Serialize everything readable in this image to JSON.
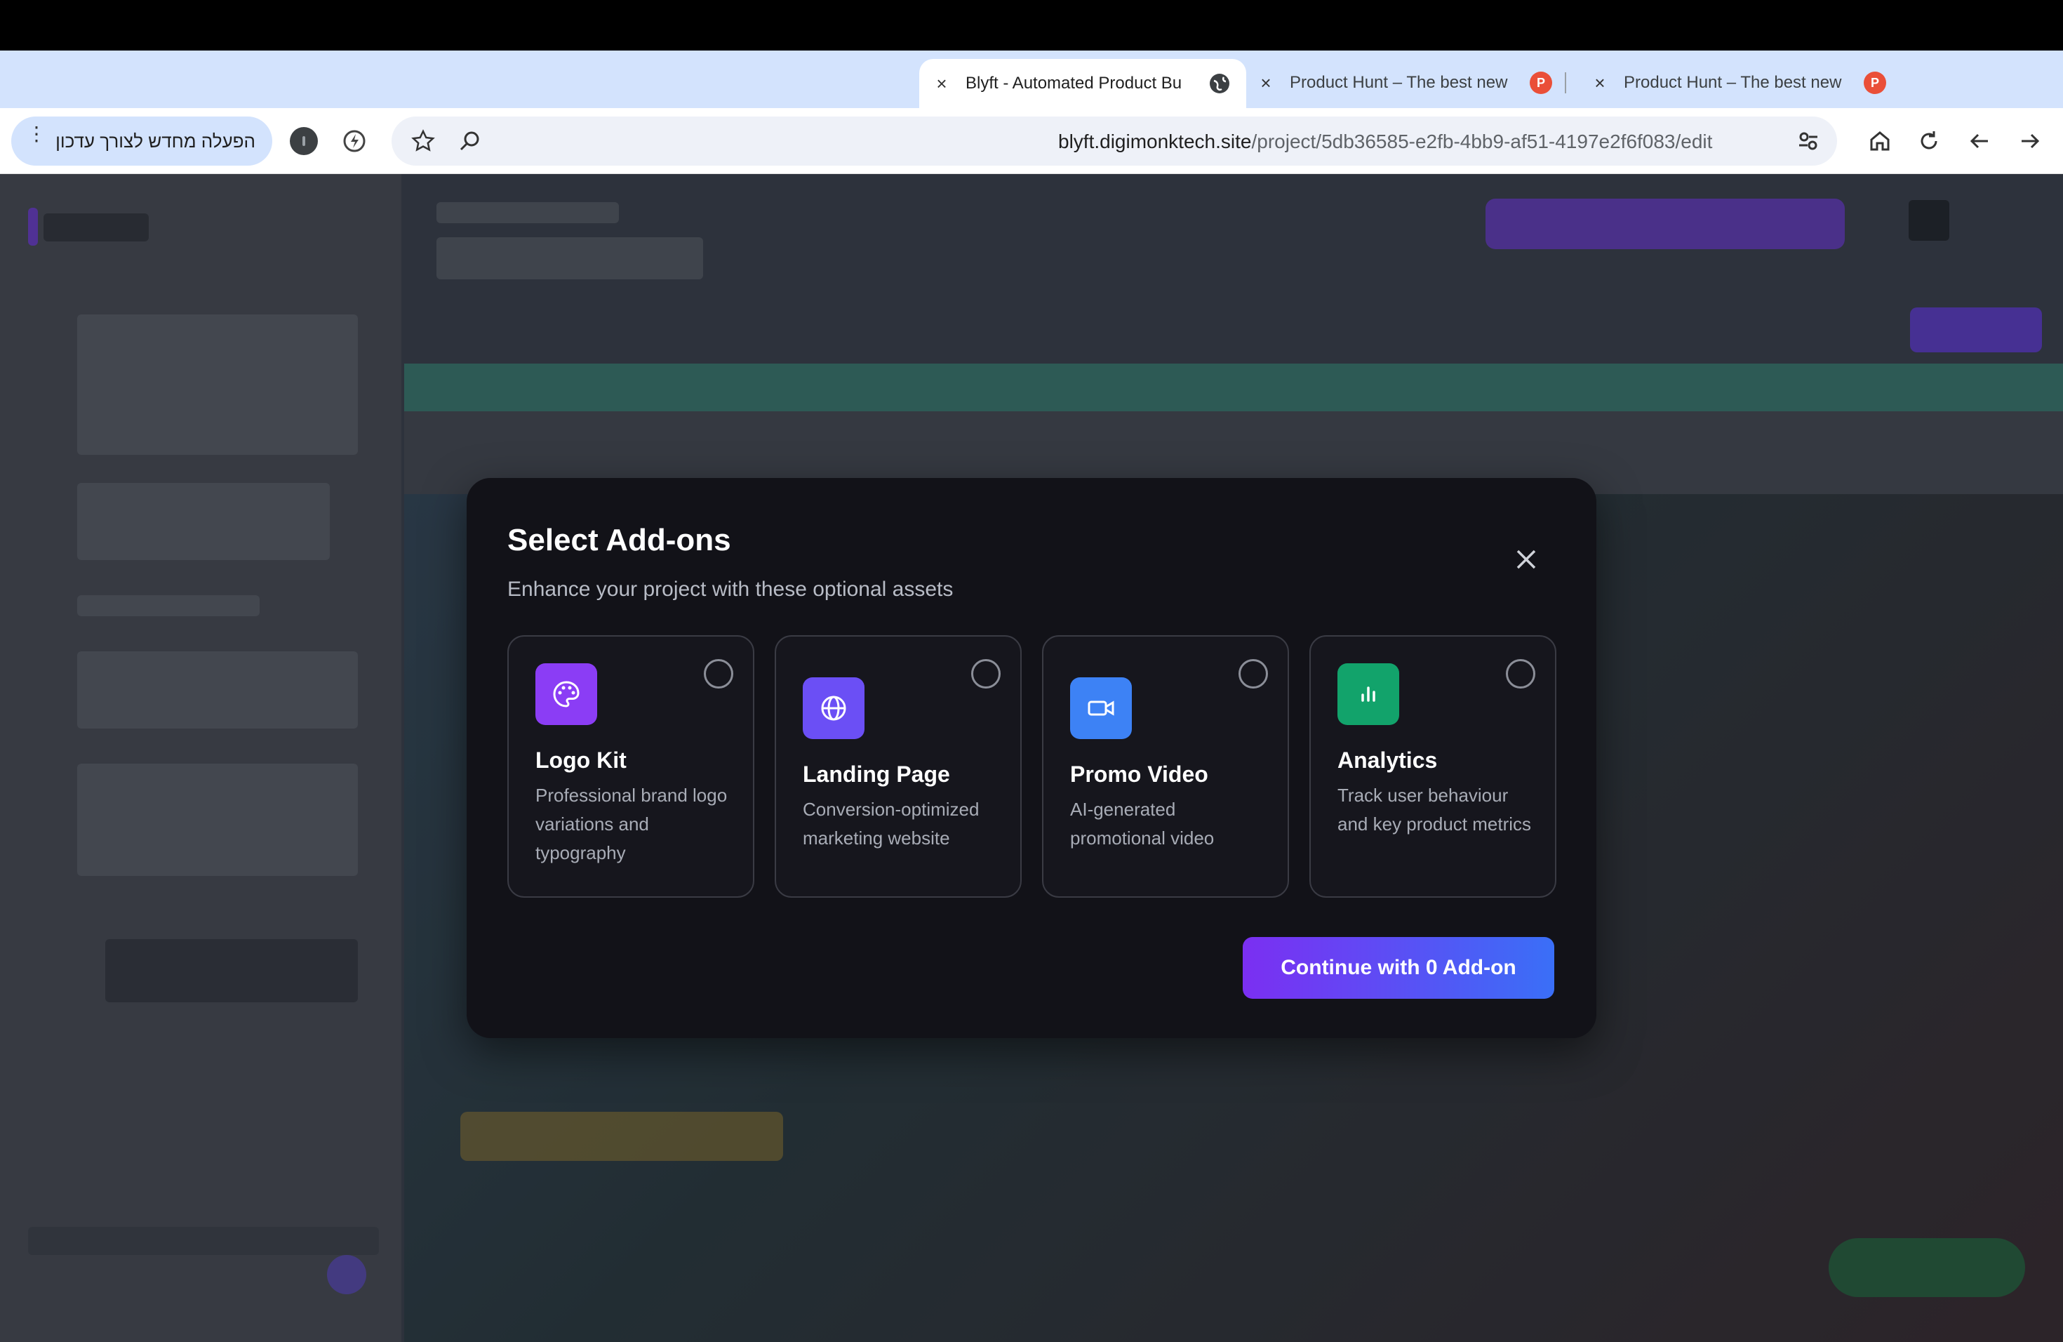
{
  "browser": {
    "tabs": [
      {
        "title": "Blyft - Automated Product Bu",
        "active": true
      },
      {
        "title": "Product Hunt – The best new",
        "active": false
      },
      {
        "title": "Product Hunt – The best new",
        "active": false
      }
    ],
    "new_tab_symbol": "+",
    "profile_chip": "הפעלה מחדש לצורך עדכון",
    "url_domain": "blyft.digimonktech.site",
    "url_path": "/project/5db36585-e2fb-4bb9-af51-4197e2f6f083/edit",
    "tab_favicon_letter": "P",
    "traffic_light_colors": [
      "#28c840",
      "#c8c8c8",
      "#ff5f57"
    ]
  },
  "modal": {
    "title": "Select Add-ons",
    "subtitle": "Enhance your project with these optional assets",
    "addons": [
      {
        "name": "Logo Kit",
        "description": "Professional brand logo variations and typography",
        "icon": "palette-icon",
        "color": "#8b3df5"
      },
      {
        "name": "Landing Page",
        "description": "Conversion-optimized marketing website",
        "icon": "globe-icon",
        "color": "#6b4ff5"
      },
      {
        "name": "Promo Video",
        "description": "AI-generated promotional video",
        "icon": "video-camera-icon",
        "color": "#3d82f5"
      },
      {
        "name": "Analytics",
        "description": "Track user behaviour and key product metrics",
        "icon": "bar-chart-icon",
        "color": "#12a36b"
      }
    ],
    "continue_label": "Continue with 0 Add-on"
  }
}
